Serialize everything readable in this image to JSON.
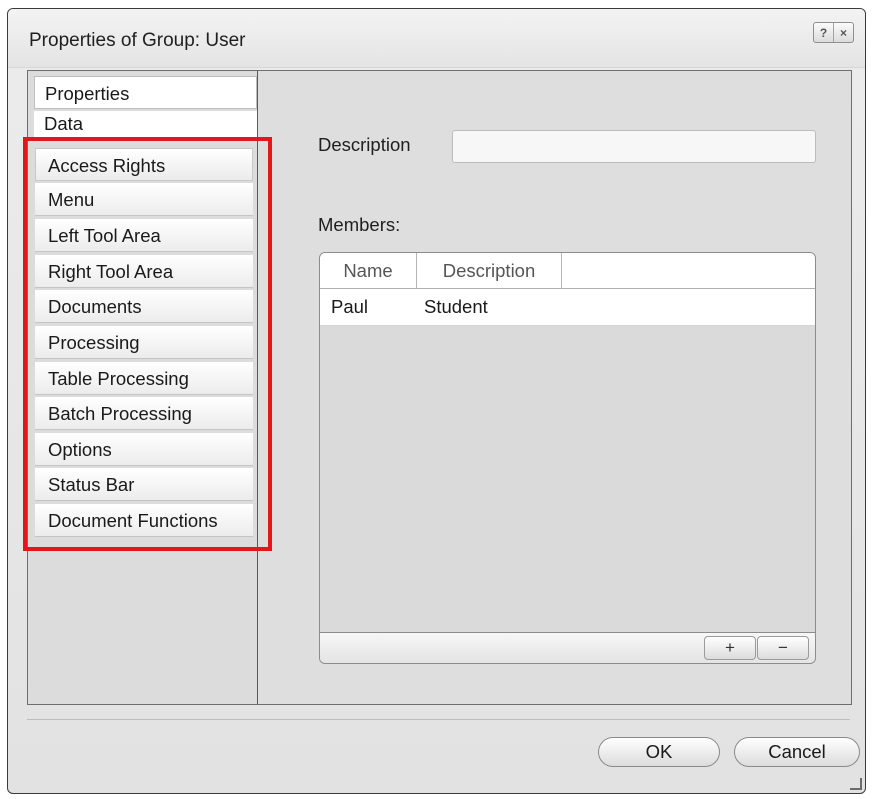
{
  "dialog": {
    "title": "Properties of Group: User",
    "help_glyph": "?",
    "close_glyph": "×"
  },
  "sidebar": {
    "items": [
      {
        "label": "Properties"
      },
      {
        "label": "Data"
      },
      {
        "label": "Access Rights"
      },
      {
        "label": "Menu"
      },
      {
        "label": "Left Tool Area"
      },
      {
        "label": "Right Tool Area"
      },
      {
        "label": "Documents"
      },
      {
        "label": "Processing"
      },
      {
        "label": "Table Processing"
      },
      {
        "label": "Batch Processing"
      },
      {
        "label": "Options"
      },
      {
        "label": "Status Bar"
      },
      {
        "label": "Document Functions"
      }
    ]
  },
  "main": {
    "description_label": "Description",
    "description_value": "",
    "members_label": "Members:",
    "table": {
      "columns": [
        "Name",
        "Description"
      ],
      "rows": [
        {
          "name": "Paul",
          "description": "Student"
        }
      ]
    },
    "add_button": "+",
    "remove_button": "−"
  },
  "buttons": {
    "ok": "OK",
    "cancel": "Cancel"
  },
  "colors": {
    "highlight": "#e0171b"
  }
}
